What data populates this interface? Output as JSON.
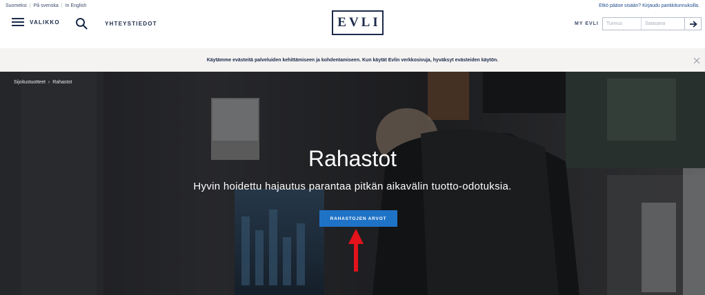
{
  "header": {
    "languages": [
      "Suomeksi",
      "På svenska",
      "In English"
    ],
    "menu_label": "VALIKKO",
    "contact_label": "YHTEYSTIEDOT",
    "logo_text": "EVLI",
    "login_hint": "Etkö pääse sisään? Kirjaudu pankkitunnuksilla.",
    "my_evli_label": "MY EVLI",
    "username_placeholder": "Tunnus",
    "password_placeholder": "Salasana"
  },
  "cookie_banner": {
    "text": "Käytämme evästeitä palveluiden kehittämiseen ja kohdentamiseen. Kun käytät Evlin verkkosivuja, hyväksyt evästeiden käytön."
  },
  "hero": {
    "breadcrumb": [
      "Sijoitustuotteet",
      "Rahastot"
    ],
    "breadcrumb_separator": "›",
    "title": "Rahastot",
    "subtitle": "Hyvin hoidettu hajautus parantaa pitkän aikavälin tuotto-odotuksia.",
    "cta_label": "RAHASTOJEN ARVOT"
  },
  "colors": {
    "brand_navy": "#1b2a4a",
    "cta_blue": "#1f73c7",
    "annotation_red": "#e3121b",
    "banner_bg": "#f4f3f1"
  }
}
